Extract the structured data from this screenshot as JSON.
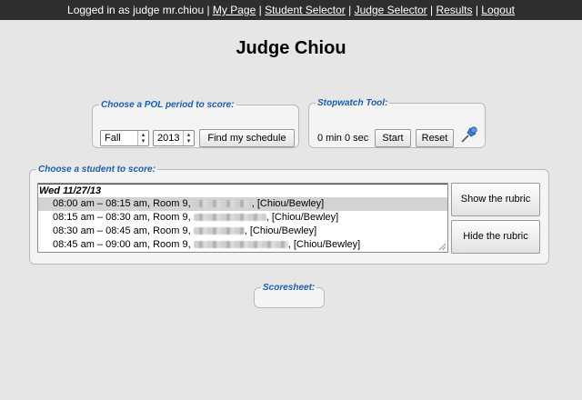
{
  "topbar": {
    "logged_in_text": "Logged in as judge mr.chiou",
    "links": [
      "My Page",
      "Student Selector",
      "Judge Selector",
      "Results",
      "Logout"
    ]
  },
  "page_title": "Judge Chiou",
  "pol_period": {
    "legend": "Choose a POL period to score:",
    "season": "Fall",
    "year": "2013",
    "find_button": "Find my schedule"
  },
  "stopwatch": {
    "legend": "Stopwatch Tool:",
    "time": "0 min 0 sec",
    "start_button": "Start",
    "reset_button": "Reset",
    "icon": "pushpin-icon"
  },
  "student_chooser": {
    "legend": "Choose a student to score:",
    "date_header": "Wed 11/27/13",
    "rows": [
      {
        "time": "08:00 am – 08:15 am, Room 9,",
        "judges": ", [Chiou/Bewley]",
        "selected": true
      },
      {
        "time": "08:15 am – 08:30 am, Room 9,",
        "judges": ", [Chiou/Bewley]",
        "selected": false
      },
      {
        "time": "08:30 am – 08:45 am, Room 9,",
        "judges": ", [Chiou/Bewley]",
        "selected": false
      },
      {
        "time": "08:45 am – 09:00 am, Room 9,",
        "judges": ", [Chiou/Bewley]",
        "selected": false
      }
    ],
    "show_button": "Show the rubric",
    "hide_button": "Hide the rubric"
  },
  "scoresheet": {
    "legend": "Scoresheet:"
  },
  "colors": {
    "topbar_bg": "#2e2e2e",
    "legend_text": "#1a5fb0",
    "page_bg": "#e6e6e6",
    "selected_row": "#d3d3d3"
  }
}
